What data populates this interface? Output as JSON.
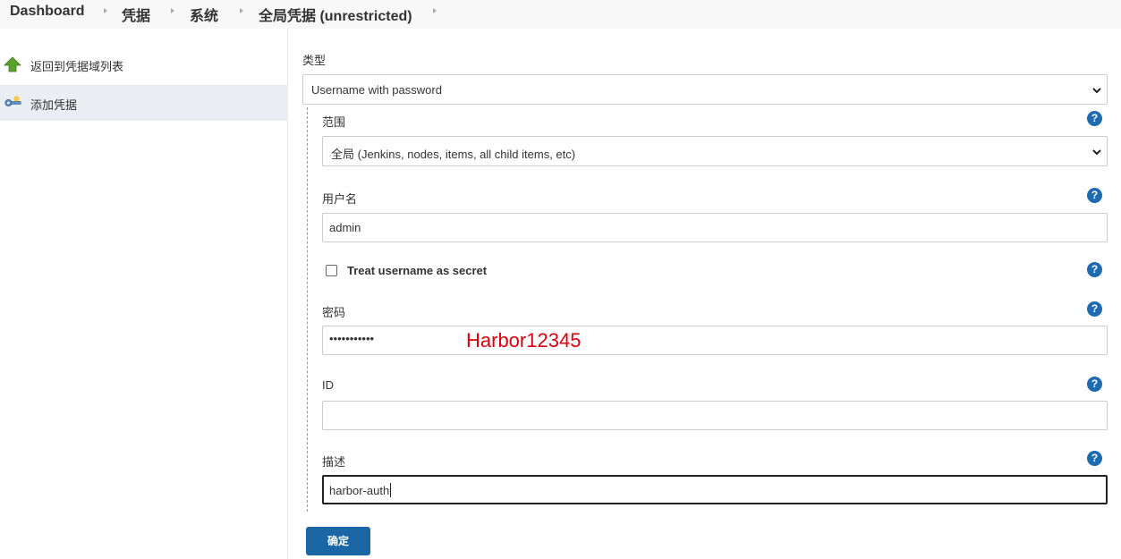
{
  "breadcrumb": {
    "items": [
      "Dashboard",
      "凭据",
      "系统",
      "全局凭据 (unrestricted)"
    ]
  },
  "sidebar": {
    "items": [
      {
        "label": "返回到凭据域列表",
        "icon": "up-arrow-icon"
      },
      {
        "label": "添加凭据",
        "icon": "credential-key-icon"
      }
    ]
  },
  "form": {
    "kind_label": "类型",
    "kind_value": "Username with password",
    "scope_label": "范围",
    "scope_value": "全局 (Jenkins, nodes, items, all child items, etc)",
    "username_label": "用户名",
    "username_value": "admin",
    "treat_secret_label": "Treat username as secret",
    "treat_secret_checked": false,
    "password_label": "密码",
    "password_masked": "•••••••••••",
    "password_annotation": "Harbor12345",
    "id_label": "ID",
    "id_value": "",
    "description_label": "描述",
    "description_value": "harbor-auth",
    "help_symbol": "?",
    "submit_label": "确定"
  },
  "colors": {
    "primary_button": "#1b67a5",
    "help_icon": "#1e6bb0",
    "annotation": "#d9000d",
    "active_sidebar": "#eaeef2"
  }
}
